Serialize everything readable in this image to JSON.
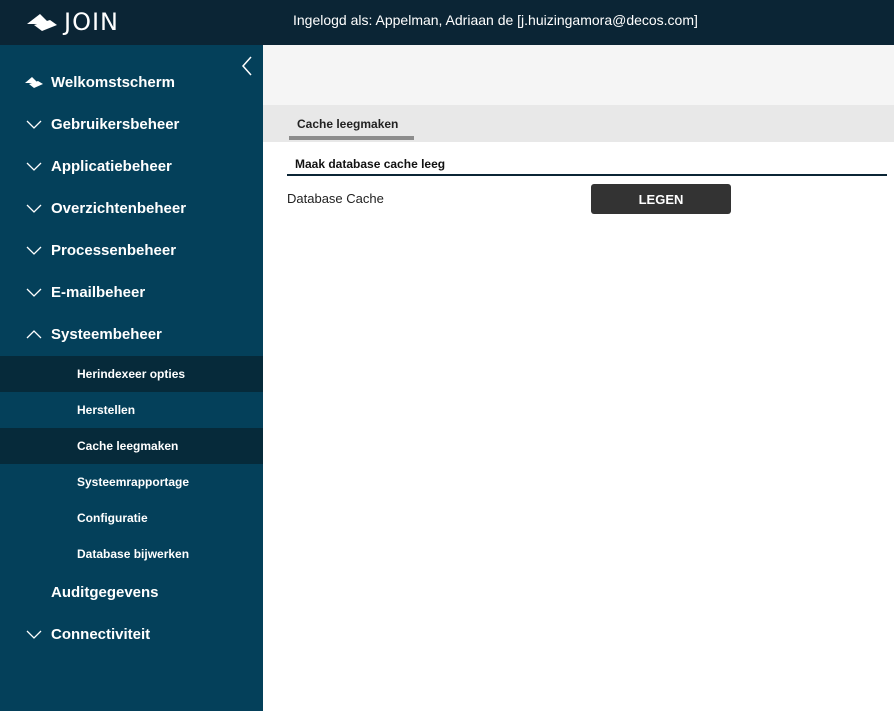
{
  "app": {
    "logo_text": "JOIN"
  },
  "header": {
    "user_info": "Ingelogd als: Appelman, Adriaan de [j.huizingamora@decos.com]"
  },
  "sidebar": {
    "items": [
      {
        "label": "Welkomstscherm",
        "icon": "home-icon"
      },
      {
        "label": "Gebruikersbeheer",
        "icon": "chevron-down-icon"
      },
      {
        "label": "Applicatiebeheer",
        "icon": "chevron-down-icon"
      },
      {
        "label": "Overzichtenbeheer",
        "icon": "chevron-down-icon"
      },
      {
        "label": "Processenbeheer",
        "icon": "chevron-down-icon"
      },
      {
        "label": "E-mailbeheer",
        "icon": "chevron-down-icon"
      },
      {
        "label": "Systeembeheer",
        "icon": "chevron-up-icon"
      },
      {
        "label": "Auditgegevens",
        "icon": ""
      },
      {
        "label": "Connectiviteit",
        "icon": "chevron-down-icon"
      }
    ],
    "subitems": [
      {
        "label": "Herindexeer opties"
      },
      {
        "label": "Herstellen"
      },
      {
        "label": "Cache leegmaken"
      },
      {
        "label": "Systeemrapportage"
      },
      {
        "label": "Configuratie"
      },
      {
        "label": "Database bijwerken"
      }
    ]
  },
  "main": {
    "tabs": [
      {
        "label": "Cache leegmaken"
      }
    ],
    "section_title": "Maak database cache leeg",
    "field_label": "Database Cache",
    "button_label": "LEGEN"
  },
  "colors": {
    "topbar": "#0b2535",
    "sidebar": "#04405a",
    "sidebar_highlight": "#062a3a",
    "button": "#333333"
  }
}
